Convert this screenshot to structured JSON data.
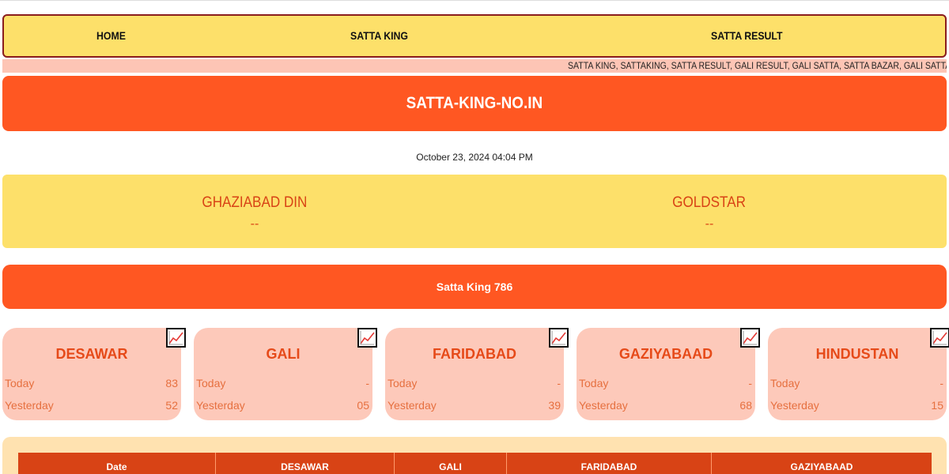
{
  "nav": {
    "items": [
      "HOME",
      "SATTA KING",
      "SATTA RESULT"
    ]
  },
  "marquee": {
    "text": "SATTA KING, SATTAKING, SATTA RESULT, GALI RESULT, GALI SATTA, SATTA BAZAR, GALI SATTA RESULT, SATTA"
  },
  "banner": {
    "title": "SATTA-KING-NO.IN"
  },
  "datetime": "October 23, 2024 04:04 PM",
  "live": [
    {
      "name": "GHAZIABAD DIN",
      "result": "--"
    },
    {
      "name": "GOLDSTAR",
      "result": "--"
    }
  ],
  "section": {
    "title": "Satta King 786"
  },
  "labels": {
    "today": "Today",
    "yesterday": "Yesterday"
  },
  "cards": [
    {
      "name": "DESAWAR",
      "today": "83",
      "yesterday": "52"
    },
    {
      "name": "GALI",
      "today": "-",
      "yesterday": "05"
    },
    {
      "name": "FARIDABAD",
      "today": "-",
      "yesterday": "39"
    },
    {
      "name": "GAZIYABAAD",
      "today": "-",
      "yesterday": "68"
    },
    {
      "name": "HINDUSTAN",
      "today": "-",
      "yesterday": "15"
    }
  ],
  "table": {
    "headers": [
      "Date",
      "DESAWAR",
      "GALI",
      "FARIDABAD",
      "GAZIYABAAD"
    ]
  },
  "colors": {
    "nav_bg": "#fde06a",
    "accent": "#ff5722",
    "card_bg": "#fdc9ba",
    "table_header": "#d84315"
  }
}
